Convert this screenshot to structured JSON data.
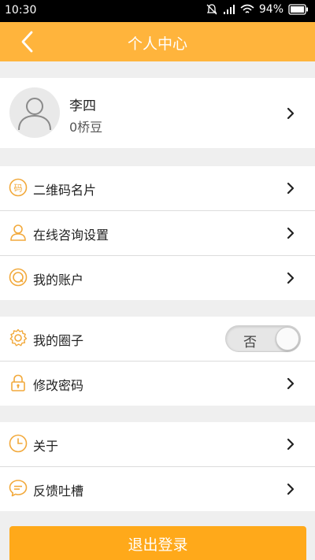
{
  "status_bar": {
    "time": "10:30",
    "battery": "94%"
  },
  "header": {
    "title": "个人中心"
  },
  "profile": {
    "name": "李四",
    "beans": "0桥豆"
  },
  "menu_group_1": [
    {
      "label": "二维码名片",
      "icon": "qrcode-icon"
    },
    {
      "label": "在线咨询设置",
      "icon": "user-icon"
    },
    {
      "label": "我的账户",
      "icon": "account-icon"
    }
  ],
  "menu_group_2": {
    "circle": {
      "label": "我的圈子",
      "icon": "gear-icon",
      "toggle_text": "否"
    },
    "password": {
      "label": "修改密码",
      "icon": "lock-icon"
    }
  },
  "menu_group_3": [
    {
      "label": "关于",
      "icon": "clock-icon"
    },
    {
      "label": "反馈吐槽",
      "icon": "chat-icon"
    }
  ],
  "logout_label": "退出登录",
  "colors": {
    "accent": "#ffb43c",
    "button": "#ffa91a",
    "icon": "#f2a93b"
  }
}
